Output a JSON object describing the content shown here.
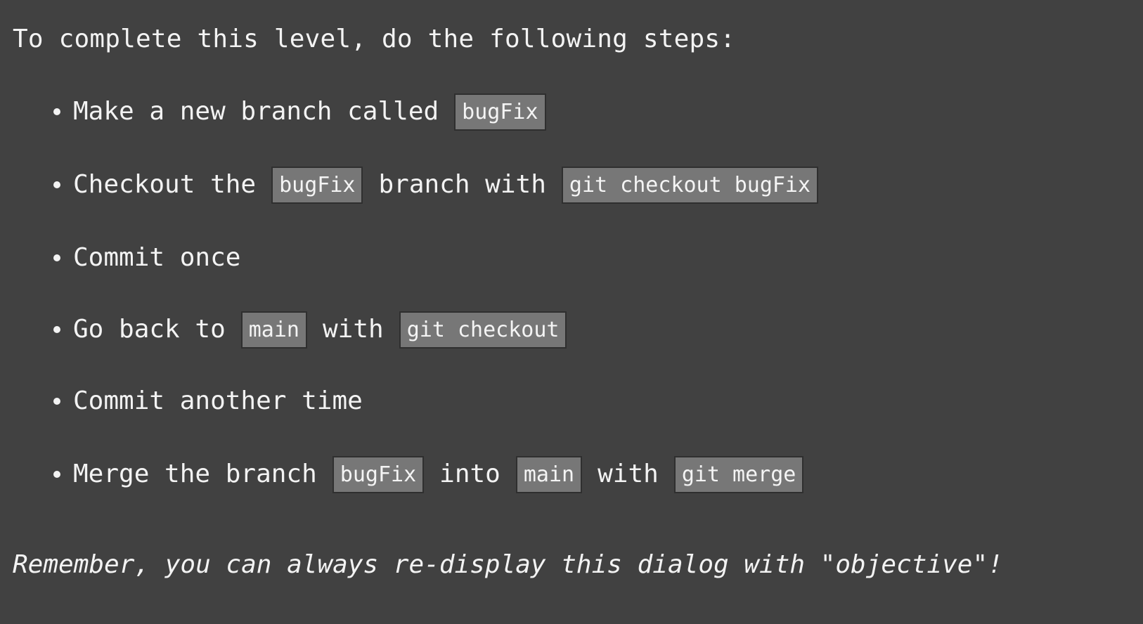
{
  "intro": "To complete this level, do the following steps:",
  "steps": [
    {
      "parts": [
        "Make a new branch called",
        "bugFix"
      ]
    },
    {
      "parts": [
        "Checkout the",
        "bugFix",
        "branch with",
        "git checkout bugFix"
      ]
    },
    {
      "parts": [
        "Commit once"
      ]
    },
    {
      "parts": [
        "Go back to",
        "main",
        "with",
        "git checkout"
      ]
    },
    {
      "parts": [
        "Commit another time"
      ]
    },
    {
      "parts": [
        "Merge the branch",
        "bugFix",
        "into",
        "main",
        "with",
        "git merge"
      ]
    }
  ],
  "footer": "Remember, you can always re-display this dialog with \"objective\"!",
  "colors": {
    "background": "#414141",
    "text": "#f3f3f3",
    "code_background": "#777777",
    "code_border": "#2f2f2f"
  }
}
